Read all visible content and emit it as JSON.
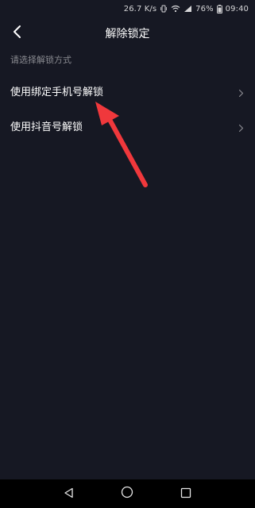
{
  "status_bar": {
    "network_speed": "26.7 K/s",
    "battery_percent": "76%",
    "time": "09:40",
    "icons": [
      "vibrate-icon",
      "wifi-icon",
      "signal-icon",
      "battery-icon"
    ]
  },
  "header": {
    "title": "解除锁定",
    "back_icon": "chevron-left-icon"
  },
  "section_label": "请选择解锁方式",
  "options": [
    {
      "label": "使用绑定手机号解锁",
      "icon": "chevron-right-icon"
    },
    {
      "label": "使用抖音号解锁",
      "icon": "chevron-right-icon"
    }
  ],
  "annotation": {
    "color": "#f0383c"
  },
  "nav_bar": {
    "icons": [
      "back-triangle-icon",
      "home-circle-icon",
      "recents-square-icon"
    ]
  },
  "colors": {
    "background": "#161823",
    "text_primary": "#ffffff",
    "text_secondary": "#8a8b91",
    "nav_background": "#000000"
  }
}
